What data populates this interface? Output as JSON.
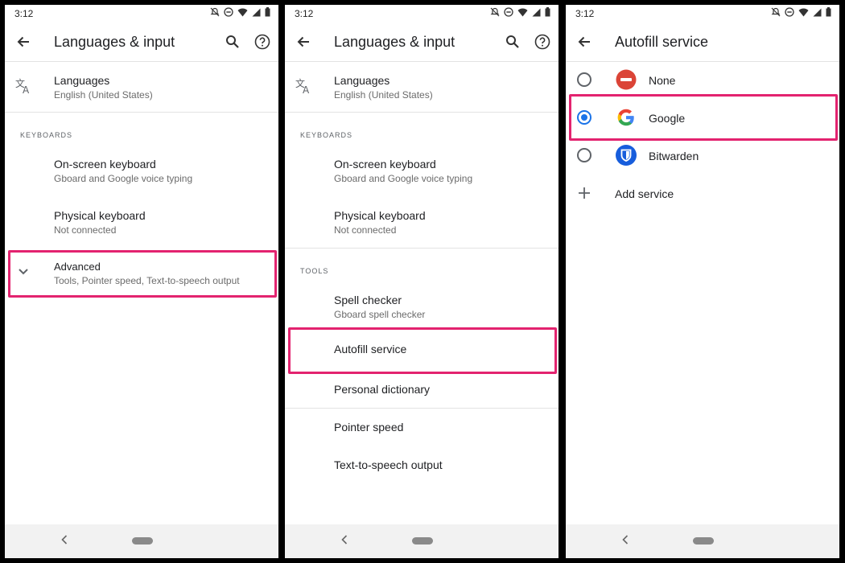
{
  "status": {
    "time": "3:12"
  },
  "screen1": {
    "title": "Languages & input",
    "languages": {
      "title": "Languages",
      "subtitle": "English (United States)"
    },
    "keyboards_header": "KEYBOARDS",
    "onscreen": {
      "title": "On-screen keyboard",
      "subtitle": "Gboard and Google voice typing"
    },
    "physical": {
      "title": "Physical keyboard",
      "subtitle": "Not connected"
    },
    "advanced": {
      "title": "Advanced",
      "subtitle": "Tools, Pointer speed, Text-to-speech output"
    }
  },
  "screen2": {
    "title": "Languages & input",
    "languages": {
      "title": "Languages",
      "subtitle": "English (United States)"
    },
    "keyboards_header": "KEYBOARDS",
    "onscreen": {
      "title": "On-screen keyboard",
      "subtitle": "Gboard and Google voice typing"
    },
    "physical": {
      "title": "Physical keyboard",
      "subtitle": "Not connected"
    },
    "tools_header": "TOOLS",
    "spell": {
      "title": "Spell checker",
      "subtitle": "Gboard spell checker"
    },
    "autofill": {
      "title": "Autofill service"
    },
    "dictionary": {
      "title": "Personal dictionary"
    },
    "pointer": {
      "title": "Pointer speed"
    },
    "tts": {
      "title": "Text-to-speech output"
    }
  },
  "screen3": {
    "title": "Autofill service",
    "options": [
      {
        "label": "None",
        "selected": false,
        "icon": "none-icon"
      },
      {
        "label": "Google",
        "selected": true,
        "icon": "google-icon"
      },
      {
        "label": "Bitwarden",
        "selected": false,
        "icon": "bitwarden-icon"
      }
    ],
    "add_service": "Add service"
  },
  "colors": {
    "highlight": "#e3236f",
    "accent": "#1a73e8"
  }
}
